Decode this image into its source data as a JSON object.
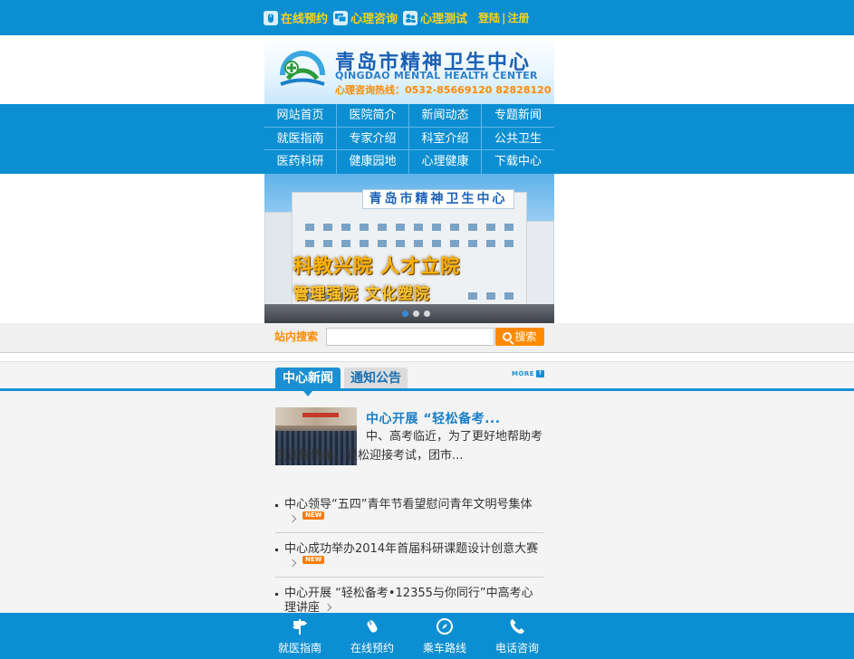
{
  "topbar": {
    "links": [
      {
        "label": "在线预约",
        "icon": "mouse-icon"
      },
      {
        "label": "心理咨询",
        "icon": "chat-icon"
      },
      {
        "label": "心理测试",
        "icon": "users-icon"
      }
    ],
    "login": "登陆",
    "separator": "|",
    "register": "注册"
  },
  "logo": {
    "name_cn": "青岛市精神卫生中心",
    "name_en": "QINGDAO MENTAL HEALTH CENTER",
    "hotline": "心理咨询热线：0532-85669120  82828120"
  },
  "nav": {
    "items": [
      "网站首页",
      "医院简介",
      "新闻动态",
      "专题新闻",
      "就医指南",
      "专家介绍",
      "科室介绍",
      "公共卫生",
      "医药科研",
      "健康园地",
      "心理健康",
      "下载中心"
    ]
  },
  "banner": {
    "sign": "青岛市精神卫生中心",
    "slogan_line1": "科教兴院  人才立院",
    "slogan_line2": "管理强院  文化塑院",
    "slides_total": 3,
    "slide_active": 1
  },
  "search": {
    "label": "站内搜索",
    "placeholder": "",
    "button": "搜索"
  },
  "tabs": {
    "active": "中心新闻",
    "inactive": "通知公告",
    "more": "MORE"
  },
  "feature": {
    "title": "中心开展 “轻松备考...",
    "desc": "中、高考临近，为了更好地帮助考生调整情绪，轻松迎接考试，团市..."
  },
  "news": [
    {
      "title": "中心领导“五四”青年节看望慰问青年文明号集体",
      "badge": "NEW"
    },
    {
      "title": "中心成功举办2014年首届科研课题设计创意大赛",
      "badge": "NEW"
    },
    {
      "title": "中心开展 “轻松备考•12355与你同行”中高考心理讲座",
      "badge": ""
    }
  ],
  "bottom": {
    "items": [
      {
        "label": "就医指南",
        "icon": "signpost-icon"
      },
      {
        "label": "在线预约",
        "icon": "mouse-icon"
      },
      {
        "label": "乘车路线",
        "icon": "compass-icon"
      },
      {
        "label": "电话咨询",
        "icon": "phone-icon"
      }
    ]
  },
  "colors": {
    "primary_blue": "#0c8fd2",
    "accent_yellow": "#ffd21a",
    "accent_orange": "#ff8a00"
  }
}
